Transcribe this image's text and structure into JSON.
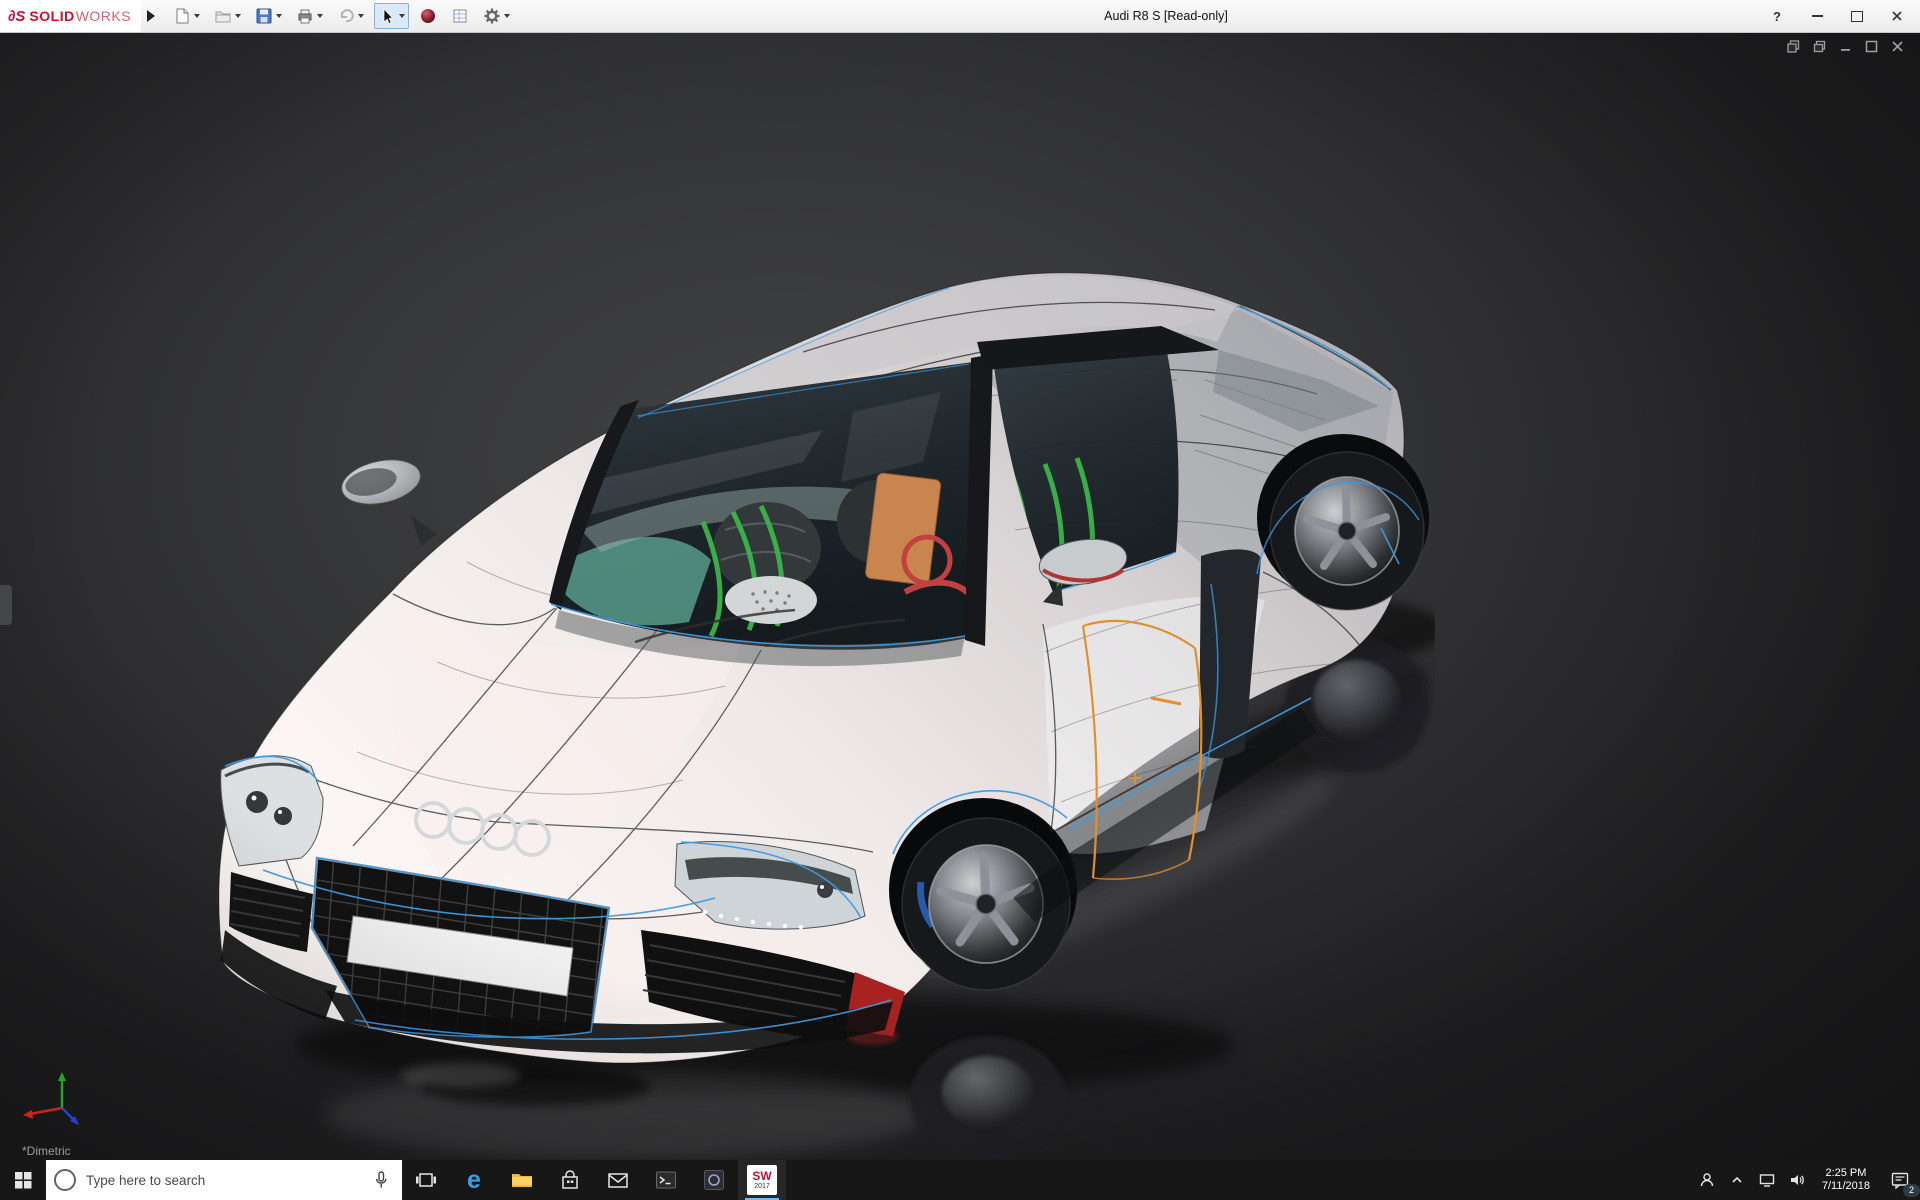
{
  "titlebar": {
    "brand_mark": "∂S",
    "brand_solid": "SOLID",
    "brand_works": "WORKS",
    "document_title": "Audi R8 S [Read-only]",
    "help_label": "?"
  },
  "toolbar_icons": [
    "new-document",
    "open",
    "save",
    "print",
    "undo",
    "select-cursor",
    "render-sphere",
    "drawing-sheet",
    "options-gear"
  ],
  "viewport": {
    "view_orientation_label": "*Dimetric"
  },
  "taskbar": {
    "search": {
      "placeholder": "Type here to search"
    },
    "edge_letter": "e",
    "solidworks_tile": {
      "line1": "SW",
      "line2": "2017"
    },
    "tray": {
      "time": "2:25 PM",
      "date": "7/11/2018",
      "notification_count": "2"
    }
  },
  "colors": {
    "accent_blue_feature_lines": "#3d9ae0",
    "accent_orange_door": "#e2902e",
    "brand_red": "#c8102e",
    "bumper_red_accent": "#a92222"
  }
}
